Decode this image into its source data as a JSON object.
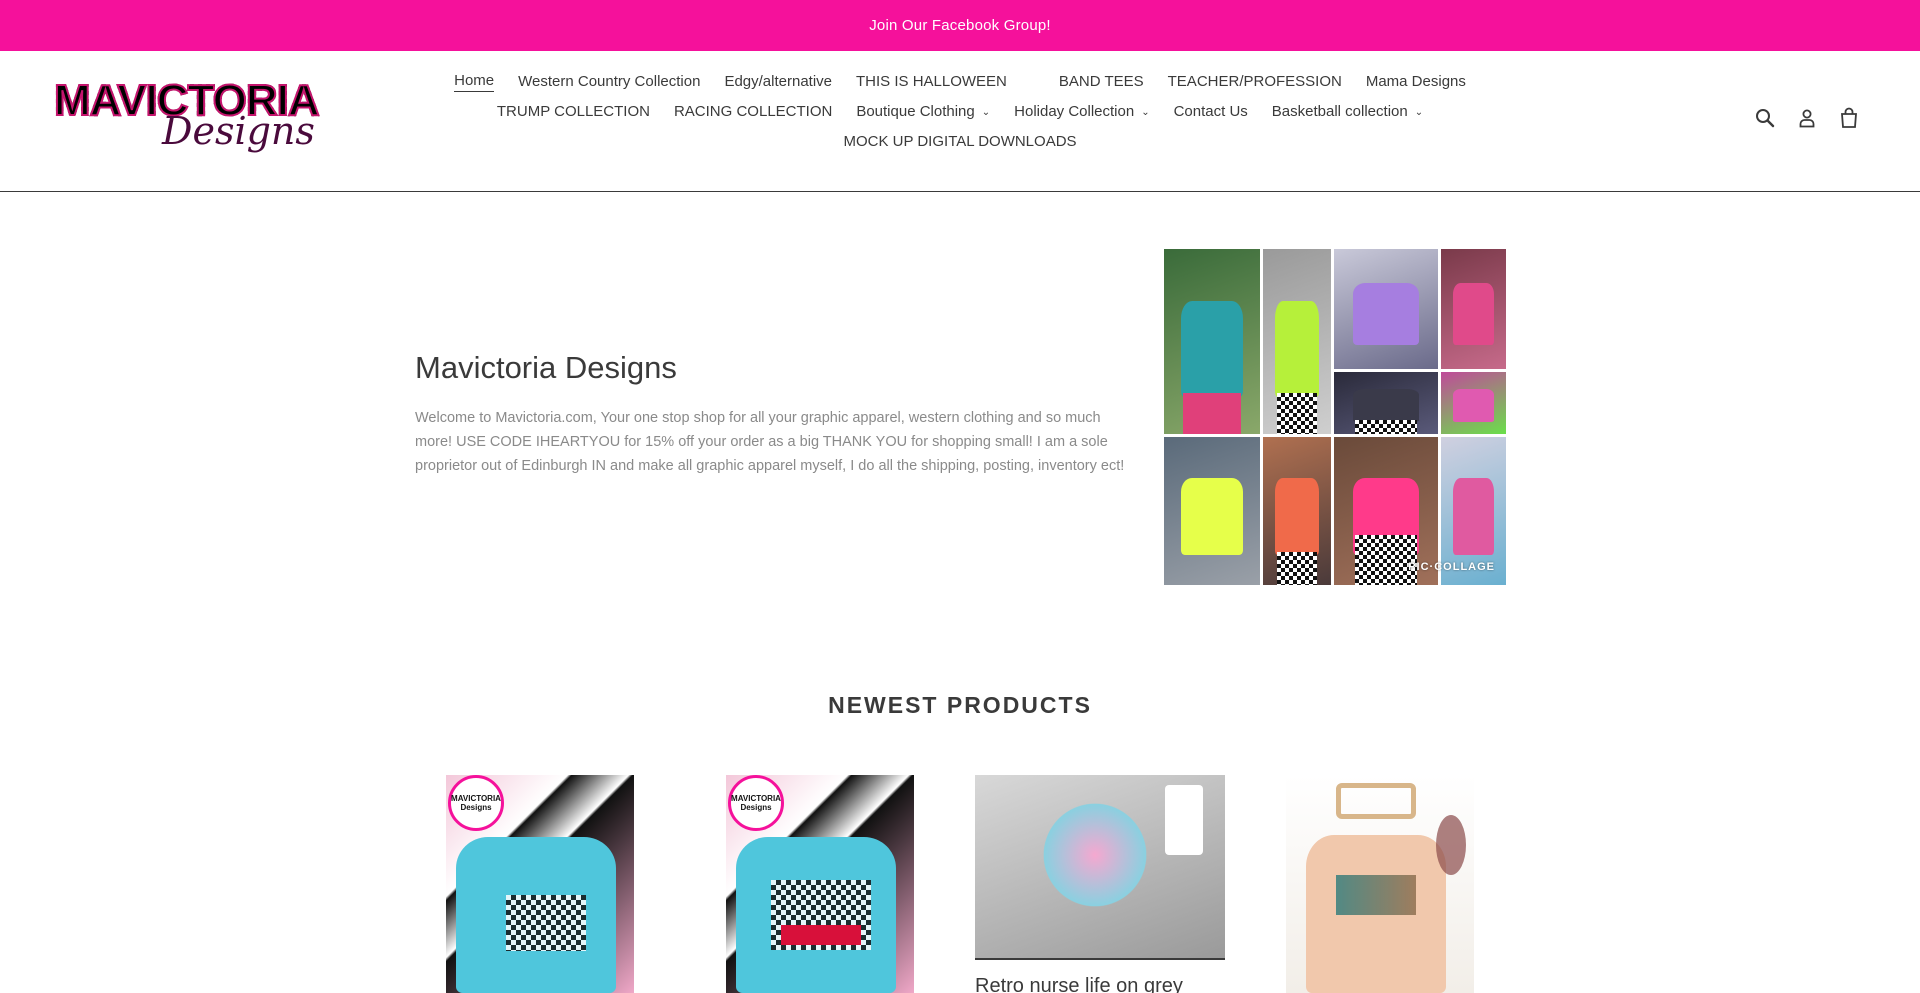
{
  "announcement": {
    "text": "Join Our Facebook Group!"
  },
  "brand": {
    "logo_line1": "MAVICTORIA",
    "logo_line2": "Designs",
    "accent_color": "#f5119b",
    "logo_color": "#c5146d"
  },
  "nav": {
    "rows": [
      [
        {
          "label": "Home",
          "active": true,
          "dropdown": false
        },
        {
          "label": "Western Country Collection",
          "active": false,
          "dropdown": false
        },
        {
          "label": "Edgy/alternative",
          "active": false,
          "dropdown": false
        },
        {
          "label": "THIS IS HALLOWEEN",
          "active": false,
          "dropdown": false
        },
        {
          "label": "BAND TEES",
          "active": false,
          "dropdown": false
        },
        {
          "label": "TEACHER/PROFESSION",
          "active": false,
          "dropdown": false
        },
        {
          "label": "Mama Designs",
          "active": false,
          "dropdown": false
        }
      ],
      [
        {
          "label": "TRUMP COLLECTION",
          "active": false,
          "dropdown": false
        },
        {
          "label": "RACING COLLECTION",
          "active": false,
          "dropdown": false
        },
        {
          "label": "Boutique Clothing",
          "active": false,
          "dropdown": true
        },
        {
          "label": "Holiday Collection",
          "active": false,
          "dropdown": true
        },
        {
          "label": "Contact Us",
          "active": false,
          "dropdown": false
        },
        {
          "label": "Basketball collection",
          "active": false,
          "dropdown": true
        }
      ],
      [
        {
          "label": "MOCK UP DIGITAL DOWNLOADS",
          "active": false,
          "dropdown": false
        }
      ]
    ]
  },
  "header_icons": [
    "search-icon",
    "account-icon",
    "cart-icon"
  ],
  "hero": {
    "title": "Mavictoria Designs",
    "text": "Welcome to Mavictoria.com, Your one stop shop for all your graphic apparel, western clothing and so much more! USE CODE IHEARTYOU for 15% off your order as a big THANK YOU for shopping small! I am a sole proprietor out of Edinburgh IN and make all graphic apparel myself, I do all the shipping, posting, inventory ect!",
    "image_watermark": "PIC·COLLAGE"
  },
  "newest": {
    "title": "NEWEST PRODUCTS",
    "products": [
      {
        "badge": "MAVICTORIA Designs",
        "title": ""
      },
      {
        "badge": "MAVICTORIA Designs",
        "title": ""
      },
      {
        "badge": "",
        "title": "Retro nurse life on grey"
      },
      {
        "badge": "",
        "title": ""
      }
    ]
  }
}
